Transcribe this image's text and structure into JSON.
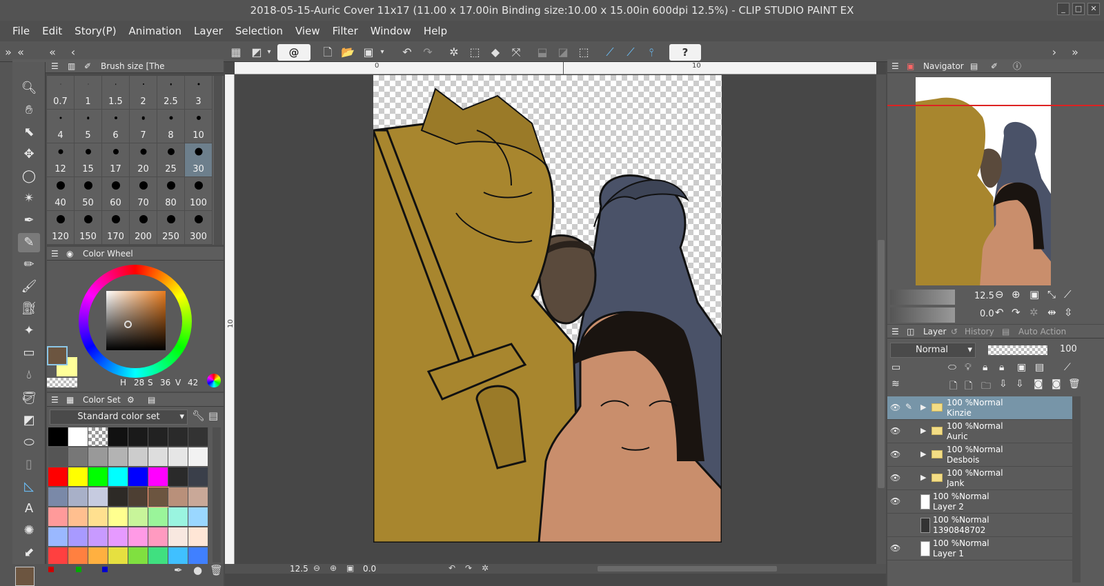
{
  "window": {
    "title": "2018-05-15-Auric Cover 11x17 (11.00 x 17.00in Binding size:10.00 x 15.00in 600dpi 12.5%) - CLIP STUDIO PAINT EX"
  },
  "menu": [
    "File",
    "Edit",
    "Story(P)",
    "Animation",
    "Layer",
    "Selection",
    "View",
    "Filter",
    "Window",
    "Help"
  ],
  "brush_panel": {
    "title": "Brush size [The Commissioner]",
    "sizes": [
      "0.7",
      "1",
      "1.5",
      "2",
      "2.5",
      "3",
      "4",
      "5",
      "6",
      "7",
      "8",
      "10",
      "12",
      "15",
      "17",
      "20",
      "25",
      "30",
      "40",
      "50",
      "60",
      "70",
      "80",
      "100",
      "120",
      "150",
      "170",
      "200",
      "250",
      "300"
    ],
    "selected": "30"
  },
  "color_wheel": {
    "title": "Color Wheel",
    "h_label": "H",
    "h": "28",
    "s_label": "S",
    "s": "36",
    "v_label": "V",
    "v": "42",
    "main_color": "#6c5540",
    "sub_color": "#ffff99"
  },
  "color_set": {
    "title": "Color Set",
    "set_name": "Standard color set",
    "swatches": [
      "#000000",
      "#ffffff",
      "checker",
      "#111111",
      "#1a1a1a",
      "#222222",
      "#2a2a2a",
      "#333333",
      "#555555",
      "#777777",
      "#999999",
      "#b3b3b3",
      "#cccccc",
      "#dddddd",
      "#e6e6e6",
      "#f2f2f2",
      "#ff0000",
      "#ffff00",
      "#00ff00",
      "#00ffff",
      "#0000ff",
      "#ff00ff",
      "#2a2a2a",
      "#3a3f4a",
      "#7a89a8",
      "#a8b0c8",
      "#c6cbe0",
      "#2d2a26",
      "#4d3f33",
      "#6c5540",
      "#b9907a",
      "#c9a898",
      "#ff9a9a",
      "#ffbf8f",
      "#ffe08f",
      "#ffff8f",
      "#c8f59a",
      "#9af59a",
      "#9af5e0",
      "#9ad7ff",
      "#9ab8ff",
      "#a89aff",
      "#c89aff",
      "#e69aff",
      "#ff9ae6",
      "#ff9ac0",
      "#f8e8e0",
      "#ffe6d6",
      "#ff4040",
      "#ff8040",
      "#ffb040",
      "#e6e040",
      "#80e040",
      "#40e080",
      "#40c0ff",
      "#4080ff"
    ]
  },
  "canvas": {
    "ruler_marks": [
      "0",
      "10"
    ],
    "vruler_mark": "10",
    "zoom": "12.5",
    "rotation": "0.0"
  },
  "navigator": {
    "tabs": [
      "Navigator"
    ],
    "zoom": "12.5",
    "rotation": "0.0"
  },
  "layer_panel": {
    "tabs": [
      "Layer",
      "History",
      "Auto Action"
    ],
    "blend_mode": "Normal",
    "opacity": "100",
    "layers": [
      {
        "mode": "100 %Normal",
        "name": "Kinzie",
        "type": "folder",
        "selected": true,
        "visible": true
      },
      {
        "mode": "100 %Normal",
        "name": "Auric",
        "type": "folder",
        "selected": false,
        "visible": true
      },
      {
        "mode": "100 %Normal",
        "name": "Desbois",
        "type": "folder",
        "selected": false,
        "visible": true
      },
      {
        "mode": "100 %Normal",
        "name": "Jank",
        "type": "folder",
        "selected": false,
        "visible": true
      },
      {
        "mode": "100 %Normal",
        "name": "Layer 2",
        "type": "raster",
        "selected": false,
        "visible": true
      },
      {
        "mode": "100 %Normal",
        "name": "1390848702",
        "type": "image",
        "selected": false,
        "visible": false
      },
      {
        "mode": "100 %Normal",
        "name": "Layer 1",
        "type": "raster",
        "selected": false,
        "visible": true
      }
    ]
  },
  "colors": {
    "lion_gold": "#a8862e",
    "blue_gray": "#4a5268",
    "dark_skin": "#5a4a3c",
    "skin": "#c98e6c"
  }
}
